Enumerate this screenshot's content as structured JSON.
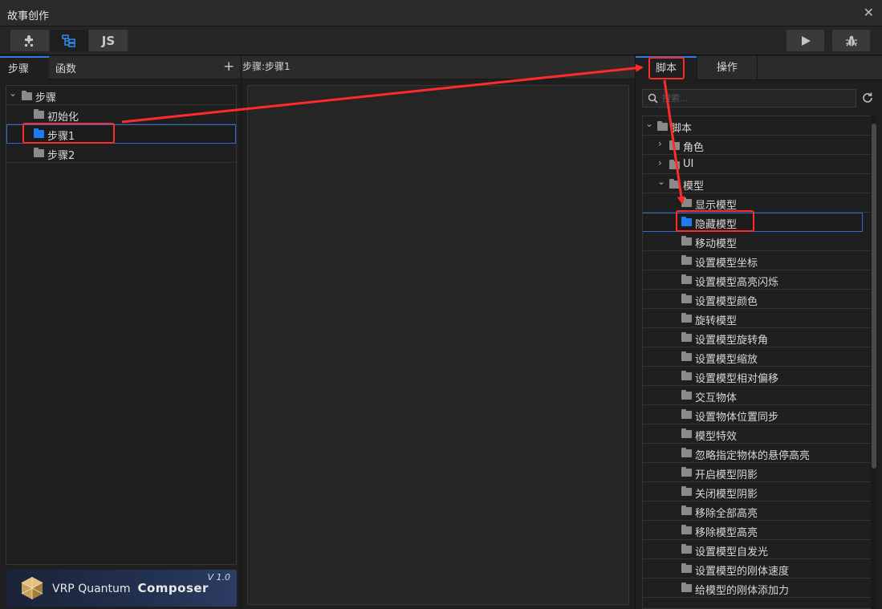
{
  "window": {
    "title": "故事创作"
  },
  "toolbar": {
    "js_label": "JS"
  },
  "left": {
    "tabs": [
      {
        "label": "步骤",
        "active": true
      },
      {
        "label": "函数",
        "active": false
      }
    ],
    "tree": {
      "root": "步骤",
      "items": [
        "初始化",
        "步骤1",
        "步骤2"
      ],
      "selected": "步骤1"
    },
    "logo": {
      "brand_light": "VRP Quantum",
      "brand_bold": "Composer",
      "version": "V 1.0"
    }
  },
  "center": {
    "breadcrumb": "步骤:步骤1"
  },
  "right": {
    "tabs": [
      {
        "label": "脚本",
        "active": true
      },
      {
        "label": "操作",
        "active": false
      }
    ],
    "search": {
      "placeholder": "搜索..."
    },
    "tree": {
      "root": "脚本",
      "groups": [
        "角色",
        "UI",
        "模型"
      ],
      "model_items": [
        "显示模型",
        "隐藏模型",
        "移动模型",
        "设置模型坐标",
        "设置模型高亮闪烁",
        "设置模型颜色",
        "旋转模型",
        "设置模型旋转角",
        "设置模型缩放",
        "设置模型相对偏移",
        "交互物体",
        "设置物体位置同步",
        "模型特效",
        "忽略指定物体的悬停高亮",
        "开启模型阴影",
        "关闭模型阴影",
        "移除全部高亮",
        "移除模型高亮",
        "设置模型自发光",
        "设置模型的刚体速度",
        "给模型的刚体添加力"
      ],
      "selected": "隐藏模型"
    }
  },
  "colors": {
    "accent": "#2d7be0",
    "selection_border": "#2e6cd0",
    "annotation": "#ff2a2a",
    "folder_blue": "#1f7cf0",
    "folder_gray": "#8a8a8a"
  },
  "icons": [
    "plugin-icon",
    "tree-icon",
    "play-icon",
    "bug-icon",
    "close-icon",
    "search-icon",
    "refresh-icon",
    "folder-icon",
    "chevron-icon",
    "add-icon"
  ]
}
